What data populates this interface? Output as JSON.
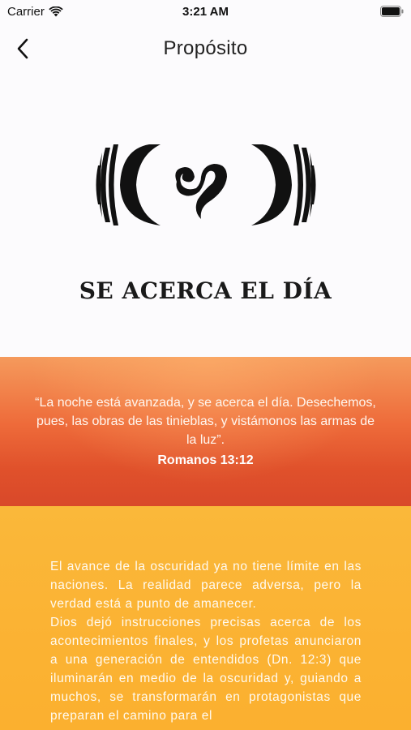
{
  "status_bar": {
    "carrier": "Carrier",
    "time": "3:21 AM"
  },
  "nav": {
    "title": "Propósito"
  },
  "hero": {
    "headline": "SE ACERCA EL DÍA"
  },
  "verse": {
    "text": "“La noche está avanzada, y se acerca el día. Desechemos, pues, las obras de las tinieblas, y vistámonos las armas de la luz”.",
    "reference": "Romanos 13:12"
  },
  "body": {
    "paragraph_1": "El avance de la oscuridad ya no tiene límite en las naciones. La realidad parece adversa, pero la verdad está a punto de amanecer.",
    "paragraph_2": "Dios dejó instrucciones precisas acerca de los acontecimientos finales, y los profetas anunciaron a una generación de entendidos (Dn. 12:3) que iluminarán en medio de la oscuridad y, guiando a muchos, se transformarán en protagonistas que preparan el camino para el"
  },
  "colors": {
    "verse_gradient_top": "#f59a5c",
    "verse_gradient_bottom": "#d9482a",
    "body_background": "#fbb334"
  }
}
